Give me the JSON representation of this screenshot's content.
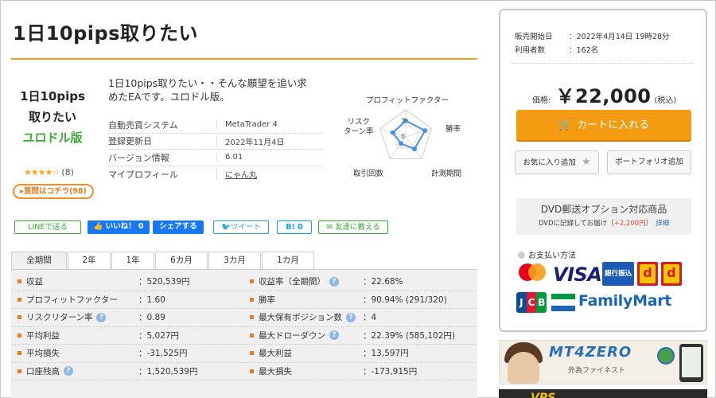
{
  "product": {
    "title": "1日10pips取りたい",
    "name_line1": "1日10pips",
    "name_line2": "取りたい",
    "name_sub": "ユロドル版",
    "stars": "★★★★☆",
    "review_count": "(8)",
    "question_label": "質問はコチラ(98)",
    "description": "1日10pips取りたい・・そんな願望を追い求めたEAです。ユロドル版。",
    "spec": [
      {
        "label": "自動売買システム",
        "value": "MetaTrader 4"
      },
      {
        "label": "登録更新日",
        "value": "2022年11月4日"
      },
      {
        "label": "バージョン情報",
        "value": "6.01"
      },
      {
        "label": "マイプロフィール",
        "value": "にゃん丸"
      }
    ]
  },
  "radar": {
    "labels": {
      "top": "プロフィットファクター",
      "right": "勝率",
      "bottom_right": "計測期間",
      "bottom_left": "取引回数",
      "left_line1": "リスク",
      "left_line2": "ターン率"
    },
    "values": [
      0.6,
      0.75,
      0.55,
      0.3,
      0.5
    ],
    "scale_top": "3",
    "scale_mid": "0",
    "color": "#4a90d9"
  },
  "share": {
    "line": "LINEで送る",
    "like": "いいね！ 0",
    "fb_share": "シェアする",
    "tweet": "ツイート",
    "hatena": "B! 0",
    "friend": "友達に教える"
  },
  "tabs": [
    "全期間",
    "2年",
    "1年",
    "6カ月",
    "3カ月",
    "1カ月"
  ],
  "stats_left": [
    {
      "label": "収益",
      "value": "：520,539円",
      "help": false
    },
    {
      "label": "プロフィットファクター",
      "value": "：1.60",
      "help": false
    },
    {
      "label": "リスクリターン率",
      "value": "：0.89",
      "help": true
    },
    {
      "label": "平均利益",
      "value": "：5,027円",
      "help": false
    },
    {
      "label": "平均損失",
      "value": "：-31,525円",
      "help": false
    },
    {
      "label": "口座残高",
      "value": "：1,520,539円",
      "help": true
    }
  ],
  "stats_right": [
    {
      "label": "収益率（全期間）",
      "value": "：22.68%",
      "help": true
    },
    {
      "label": "勝率",
      "value": "：90.94% (291/320)",
      "help": false
    },
    {
      "label": "最大保有ポジション数",
      "value": "：4",
      "help": true
    },
    {
      "label": "最大ドローダウン",
      "value": "：22.39% (585,102円)",
      "help": true
    },
    {
      "label": "最大利益",
      "value": "：13,597円",
      "help": false
    },
    {
      "label": "最大損失",
      "value": "：-173,915円",
      "help": false
    }
  ],
  "help_glyph": "?",
  "sidebar": {
    "release_label": "販売開始日",
    "release_value": "：2022年4月14日 19時28分",
    "users_label": "利用者数",
    "users_value": "：162名",
    "price_label": "価格:",
    "price_value": "￥22,000",
    "price_tax": "(税込)",
    "cart_label": "カートに入れる",
    "cart_icon": "🛒",
    "favorite_label": "お気に入り追加",
    "favorite_icon": "★",
    "portfolio_label": "ポートフォリオ追加",
    "dvd_title": "DVD郵送オプション対応商品",
    "dvd_sub": "DVDに記録してお届け（",
    "dvd_plus": "+2,200円",
    "dvd_close": "）",
    "dvd_link": "詳細",
    "payment_title": "お支払い方法",
    "pay_visa": "VISA",
    "pay_bank": "銀行振込",
    "pay_d": "d",
    "pay_jcb": [
      "J",
      "C",
      "B"
    ],
    "pay_familymart": "FamilyMart",
    "accent": "#f39c12"
  },
  "banner1": {
    "title": "MT4ZERO",
    "sub": "外為ファイネスト"
  },
  "banner2": {
    "text": "VPS"
  }
}
